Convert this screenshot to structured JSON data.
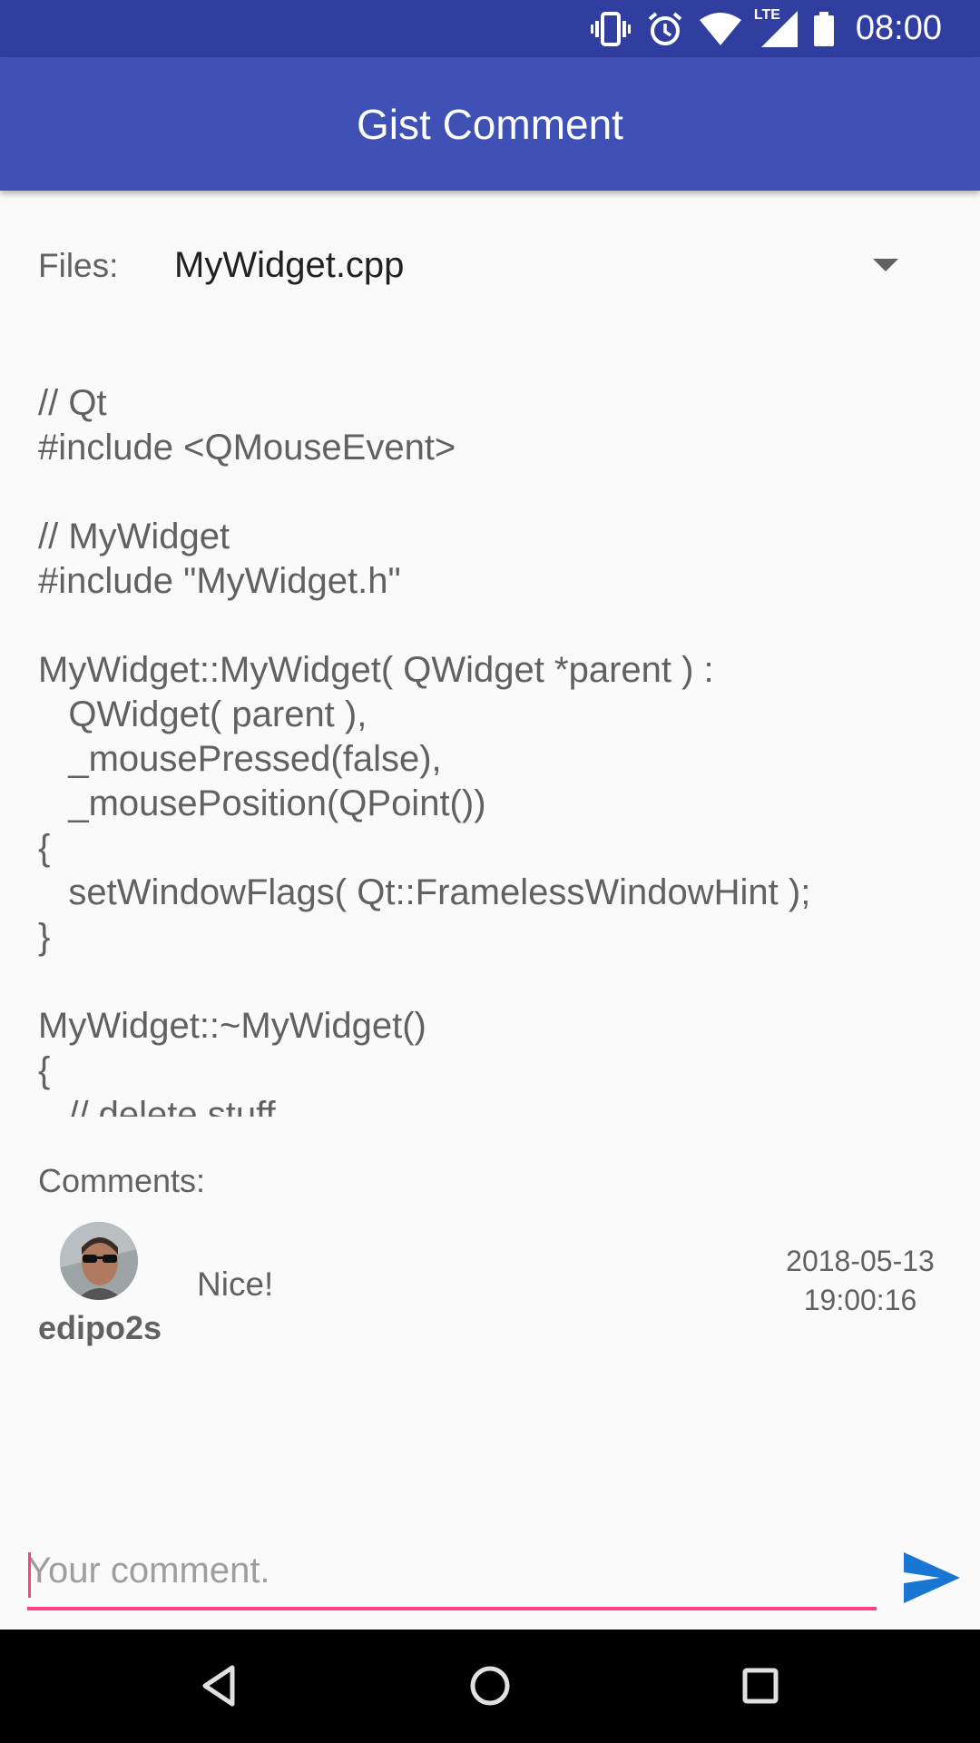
{
  "status_bar": {
    "time": "08:00",
    "icons": [
      "vibrate-icon",
      "alarm-icon",
      "wifi-icon",
      "lte-signal-icon",
      "battery-icon"
    ],
    "network_label": "LTE"
  },
  "app_bar": {
    "title": "Gist Comment"
  },
  "files": {
    "label": "Files:",
    "selected": "MyWidget.cpp"
  },
  "code": {
    "content": "// Qt\n#include <QMouseEvent>\n\n// MyWidget\n#include \"MyWidget.h\"\n\nMyWidget::MyWidget( QWidget *parent ) :\n   QWidget( parent ),\n   _mousePressed(false),\n   _mousePosition(QPoint())\n{\n   setWindowFlags( Qt::FramelessWindowHint );\n}\n\nMyWidget::~MyWidget()\n{\n   // delete stuff"
  },
  "comments": {
    "label": "Comments:",
    "items": [
      {
        "author": "edipo2s",
        "text": "Nice!",
        "date": "2018-05-13",
        "time": "19:00:16"
      }
    ]
  },
  "input": {
    "placeholder": "Your comment.",
    "value": ""
  },
  "colors": {
    "status_bar": "#303f9f",
    "app_bar": "#3f51b5",
    "accent": "#ff4081",
    "send": "#1976d2"
  }
}
